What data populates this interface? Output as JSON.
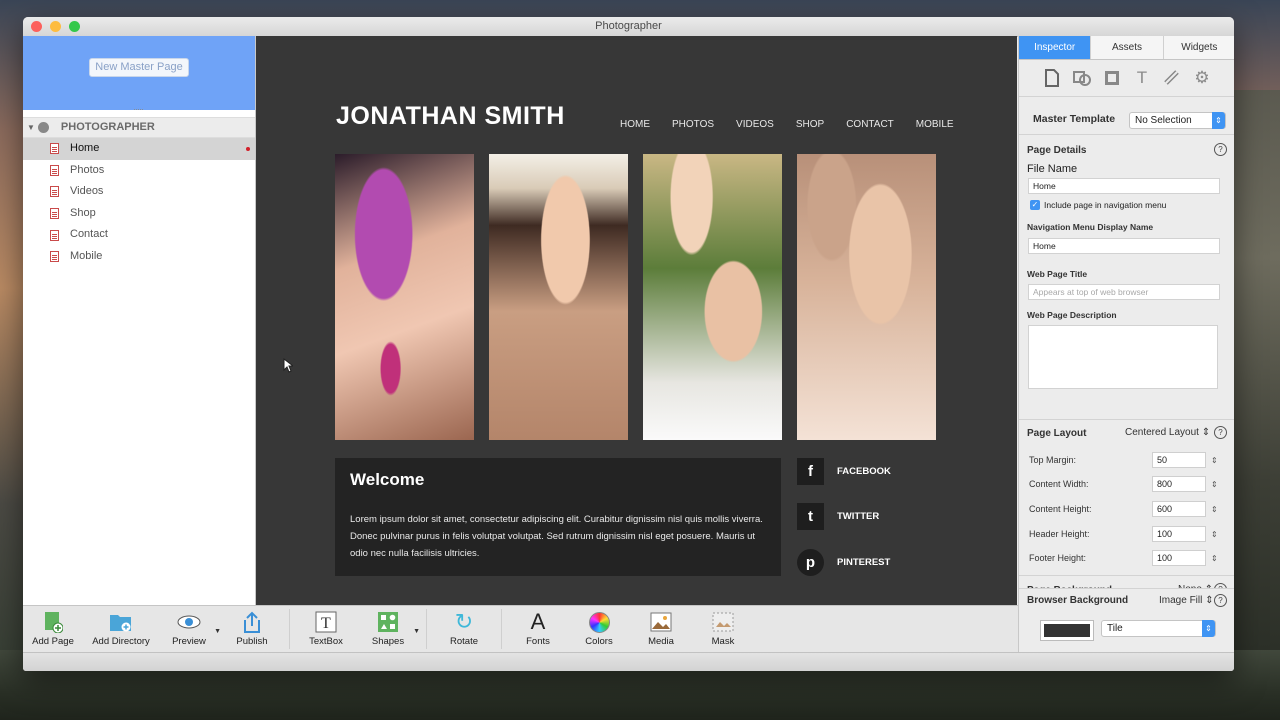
{
  "window": {
    "title": "Photographer"
  },
  "sidebar": {
    "new_master_button": "New Master Page",
    "site_name": "PHOTOGRAPHER",
    "pages": [
      {
        "label": "Home",
        "selected": true
      },
      {
        "label": "Photos",
        "selected": false
      },
      {
        "label": "Videos",
        "selected": false
      },
      {
        "label": "Shop",
        "selected": false
      },
      {
        "label": "Contact",
        "selected": false
      },
      {
        "label": "Mobile",
        "selected": false
      }
    ]
  },
  "canvas": {
    "site_title": "JONATHAN SMITH",
    "nav": [
      "HOME",
      "PHOTOS",
      "VIDEOS",
      "SHOP",
      "CONTACT",
      "MOBILE"
    ],
    "welcome_title": "Welcome",
    "welcome_text": "Lorem ipsum dolor sit amet, consectetur adipiscing elit. Curabitur dignissim nisl quis mollis viverra. Donec pulvinar purus in felis volutpat volutpat. Sed rutrum dignissim nisl eget posuere. Mauris ut odio nec nulla facilisis ultricies.",
    "social": [
      {
        "label": "FACEBOOK",
        "icon": "facebook-icon",
        "glyph": "f"
      },
      {
        "label": "TWITTER",
        "icon": "twitter-icon",
        "glyph": "t"
      },
      {
        "label": "PINTEREST",
        "icon": "pinterest-icon",
        "glyph": "p"
      }
    ]
  },
  "inspector": {
    "tabs": [
      "Inspector",
      "Assets",
      "Widgets"
    ],
    "active_tab": "Inspector",
    "master_template_label": "Master Template",
    "master_template_value": "No Selection",
    "page_details_label": "Page Details",
    "file_name_label": "File Name",
    "file_name_value": "Home",
    "include_nav_label": "Include page in navigation menu",
    "include_nav_checked": true,
    "nav_display_name_label": "Navigation Menu Display Name",
    "nav_display_name_value": "Home",
    "web_page_title_label": "Web Page Title",
    "web_page_title_placeholder": "Appears at top of web browser",
    "web_page_description_label": "Web Page Description",
    "page_layout_label": "Page Layout",
    "page_layout_value": "Centered Layout",
    "layout_fields": [
      {
        "label": "Top Margin:",
        "value": "50"
      },
      {
        "label": "Content Width:",
        "value": "800"
      },
      {
        "label": "Content Height:",
        "value": "600"
      },
      {
        "label": "Header Height:",
        "value": "100"
      },
      {
        "label": "Footer Height:",
        "value": "100"
      }
    ],
    "page_background_label": "Page Background",
    "page_background_value": "None",
    "browser_background_label": "Browser Background",
    "browser_background_value": "Image Fill",
    "tile_value": "Tile"
  },
  "toolbar": {
    "add_page": "Add Page",
    "add_directory": "Add Directory",
    "preview": "Preview",
    "publish": "Publish",
    "textbox": "TextBox",
    "shapes": "Shapes",
    "rotate": "Rotate",
    "fonts": "Fonts",
    "colors": "Colors",
    "media": "Media",
    "mask": "Mask"
  },
  "colors": {
    "accent": "#3f94f3",
    "master_area": "#6fa3f7",
    "canvas": "#373737",
    "panel": "#232323"
  }
}
